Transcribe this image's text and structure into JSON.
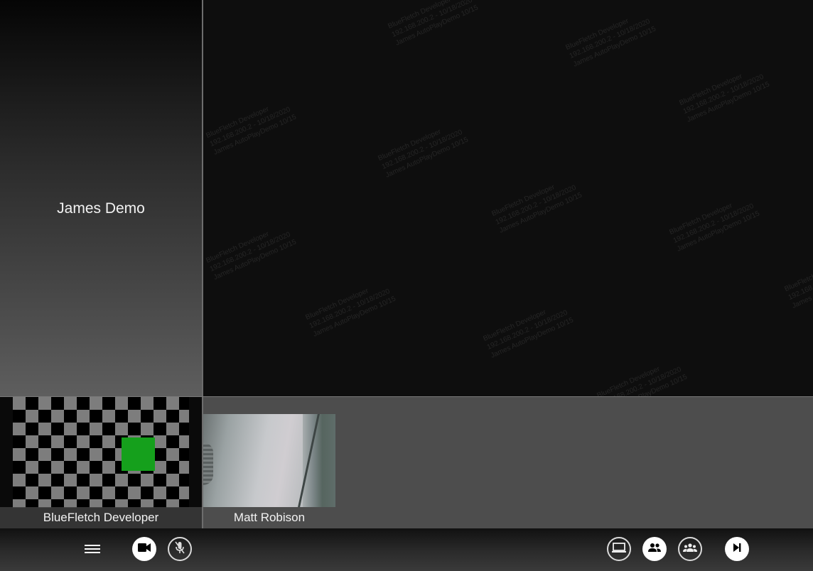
{
  "left_tile": {
    "participant_name": "James Demo"
  },
  "watermark": {
    "line1": "BlueFletch Developer",
    "line2": "192.168.200.2 - 10/18/2020",
    "line3": "James AutoPlayDemo 10/15"
  },
  "thumbnails": [
    {
      "name": "BlueFletch Developer"
    },
    {
      "name": "Matt Robison"
    }
  ],
  "toolbar": {
    "menu_icon": "hamburger-menu-icon",
    "camera_icon": "video-camera-icon",
    "mic_icon": "microphone-muted-icon",
    "screen_icon": "laptop-screen-icon",
    "participants_icon": "people-icon",
    "group_icon": "group-icon",
    "next_icon": "skip-next-icon"
  },
  "colors": {
    "stage": "#0e0e0e",
    "strip": "#4d4d4d",
    "green_square": "#15a01c"
  }
}
